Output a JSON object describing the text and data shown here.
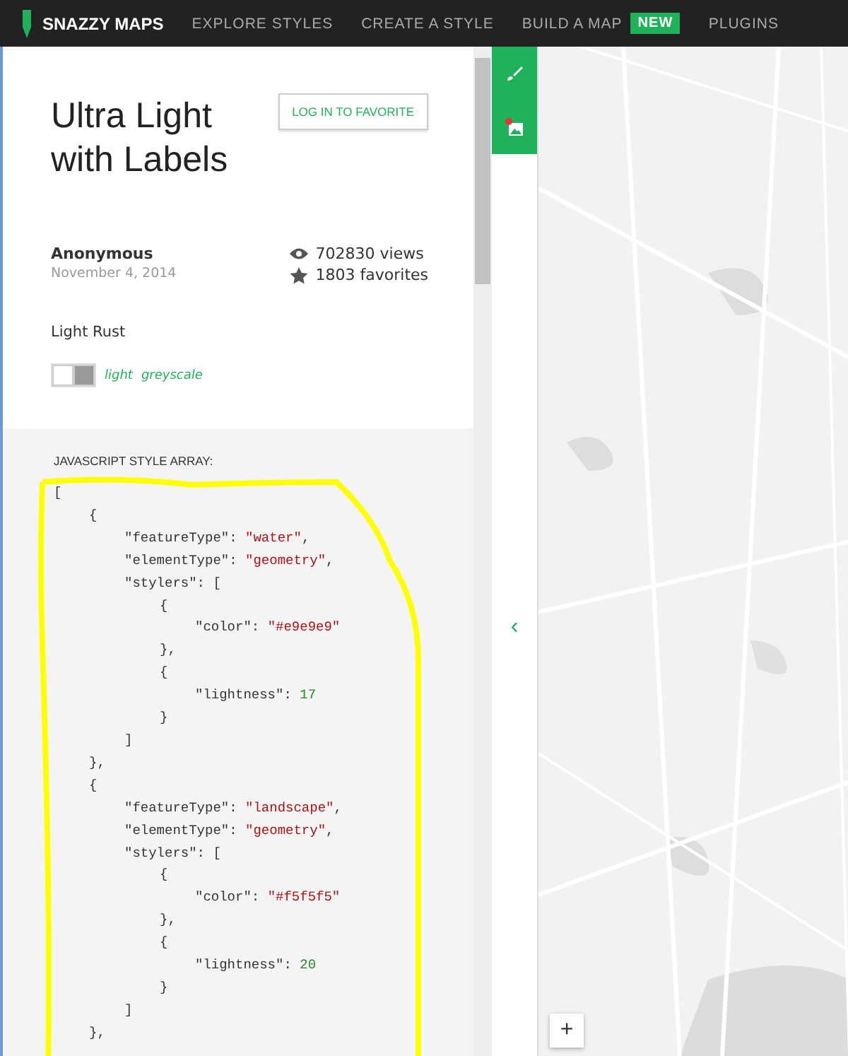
{
  "nav": {
    "logo": "SNAZZY MAPS",
    "items": [
      {
        "label": "EXPLORE STYLES"
      },
      {
        "label": "CREATE A STYLE"
      },
      {
        "label": "BUILD A MAP",
        "badge": "NEW"
      },
      {
        "label": "PLUGINS"
      }
    ]
  },
  "style": {
    "title": "Ultra Light with Labels",
    "favorite_button": "LOG IN TO FAVORITE",
    "author": "Anonymous",
    "date": "November 4, 2014",
    "views": "702830 views",
    "favorites": "1803 favorites",
    "palette_name": "Light Rust",
    "swatches": [
      {
        "color": "#ffffff"
      },
      {
        "color": "#999999"
      }
    ],
    "tags": [
      "light",
      "greyscale"
    ]
  },
  "code": {
    "label": "JAVASCRIPT STYLE ARRAY:",
    "lines": [
      {
        "parts": [
          {
            "kind": "plain",
            "text": "["
          }
        ],
        "children": [
          {
            "parts": [
              {
                "kind": "plain",
                "text": "{"
              }
            ],
            "children": [
              {
                "parts": [
                  {
                    "kind": "plain",
                    "text": "\"featureType\": "
                  },
                  {
                    "kind": "string",
                    "text": "\"water\""
                  },
                  {
                    "kind": "plain",
                    "text": ","
                  }
                ]
              },
              {
                "parts": [
                  {
                    "kind": "plain",
                    "text": "\"elementType\": "
                  },
                  {
                    "kind": "string",
                    "text": "\"geometry\""
                  },
                  {
                    "kind": "plain",
                    "text": ","
                  }
                ]
              },
              {
                "parts": [
                  {
                    "kind": "plain",
                    "text": "\"stylers\": ["
                  }
                ],
                "children": [
                  {
                    "parts": [
                      {
                        "kind": "plain",
                        "text": "{"
                      }
                    ],
                    "children": [
                      {
                        "parts": [
                          {
                            "kind": "plain",
                            "text": "\"color\": "
                          },
                          {
                            "kind": "string",
                            "text": "\"#e9e9e9\""
                          }
                        ]
                      }
                    ]
                  },
                  {
                    "parts": [
                      {
                        "kind": "plain",
                        "text": "},"
                      }
                    ]
                  },
                  {
                    "parts": [
                      {
                        "kind": "plain",
                        "text": "{"
                      }
                    ],
                    "children": [
                      {
                        "parts": [
                          {
                            "kind": "plain",
                            "text": "\"lightness\": "
                          },
                          {
                            "kind": "number",
                            "text": "17"
                          }
                        ]
                      }
                    ]
                  },
                  {
                    "parts": [
                      {
                        "kind": "plain",
                        "text": "}"
                      }
                    ]
                  }
                ]
              },
              {
                "parts": [
                  {
                    "kind": "plain",
                    "text": "]"
                  }
                ]
              }
            ]
          },
          {
            "parts": [
              {
                "kind": "plain",
                "text": "},"
              }
            ]
          },
          {
            "parts": [
              {
                "kind": "plain",
                "text": "{"
              }
            ],
            "children": [
              {
                "parts": [
                  {
                    "kind": "plain",
                    "text": "\"featureType\": "
                  },
                  {
                    "kind": "string",
                    "text": "\"landscape\""
                  },
                  {
                    "kind": "plain",
                    "text": ","
                  }
                ]
              },
              {
                "parts": [
                  {
                    "kind": "plain",
                    "text": "\"elementType\": "
                  },
                  {
                    "kind": "string",
                    "text": "\"geometry\""
                  },
                  {
                    "kind": "plain",
                    "text": ","
                  }
                ]
              },
              {
                "parts": [
                  {
                    "kind": "plain",
                    "text": "\"stylers\": ["
                  }
                ],
                "children": [
                  {
                    "parts": [
                      {
                        "kind": "plain",
                        "text": "{"
                      }
                    ],
                    "children": [
                      {
                        "parts": [
                          {
                            "kind": "plain",
                            "text": "\"color\": "
                          },
                          {
                            "kind": "string",
                            "text": "\"#f5f5f5\""
                          }
                        ]
                      }
                    ]
                  },
                  {
                    "parts": [
                      {
                        "kind": "plain",
                        "text": "},"
                      }
                    ]
                  },
                  {
                    "parts": [
                      {
                        "kind": "plain",
                        "text": "{"
                      }
                    ],
                    "children": [
                      {
                        "parts": [
                          {
                            "kind": "plain",
                            "text": "\"lightness\": "
                          },
                          {
                            "kind": "number",
                            "text": "20"
                          }
                        ]
                      }
                    ]
                  },
                  {
                    "parts": [
                      {
                        "kind": "plain",
                        "text": "}"
                      }
                    ]
                  }
                ]
              },
              {
                "parts": [
                  {
                    "kind": "plain",
                    "text": "]"
                  }
                ]
              }
            ]
          },
          {
            "parts": [
              {
                "kind": "plain",
                "text": "},"
              }
            ]
          }
        ]
      }
    ]
  },
  "map": {
    "collapse_button": "‹",
    "zoom_in": "+"
  }
}
